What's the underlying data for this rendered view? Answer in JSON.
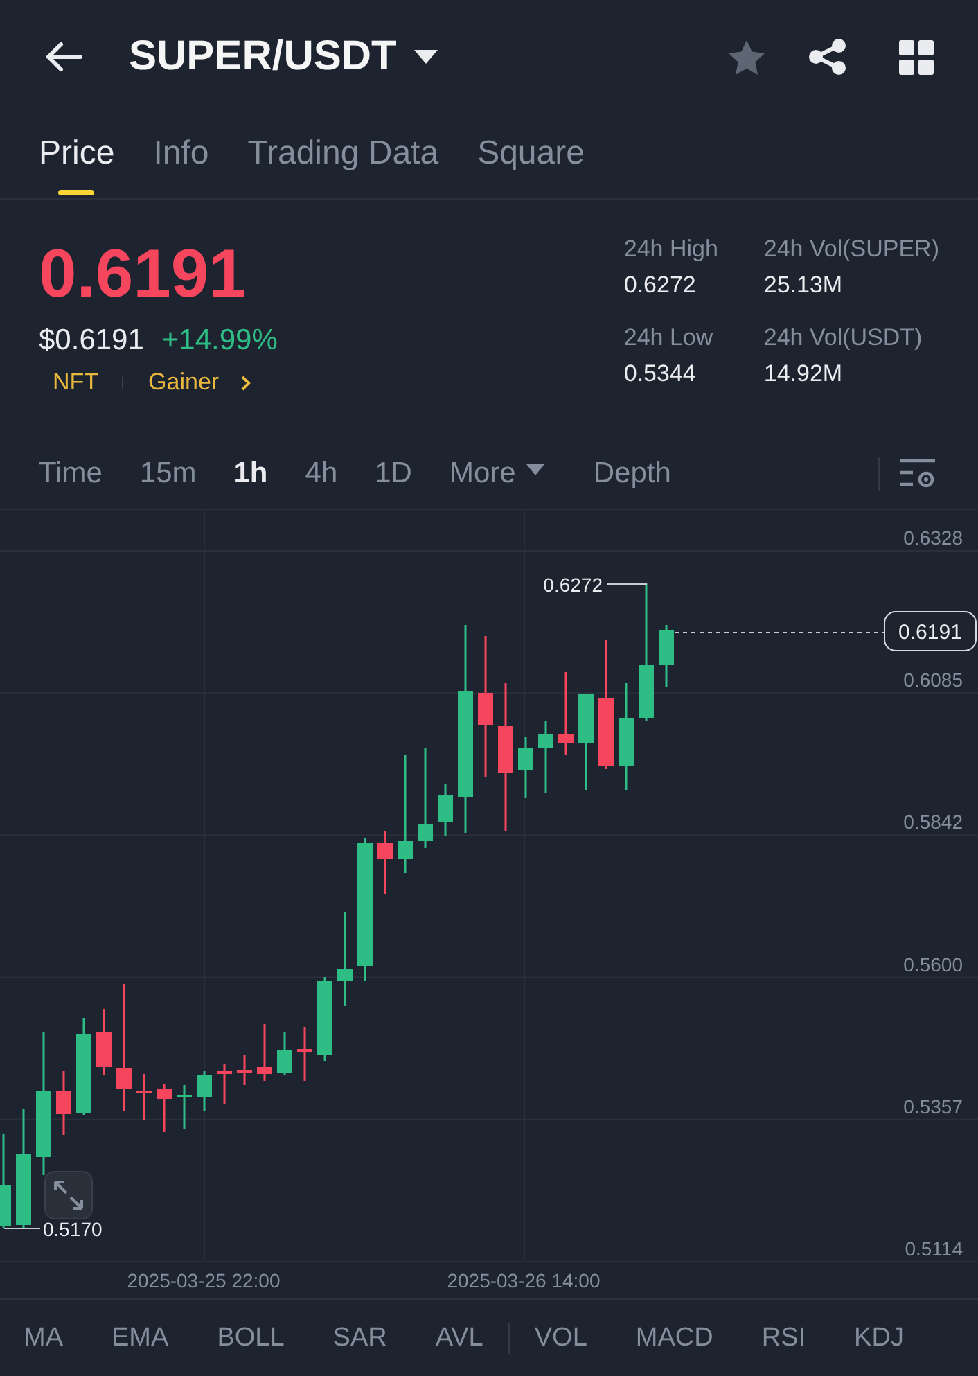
{
  "header": {
    "title": "SUPER/USDT",
    "favorited": false
  },
  "tabs": [
    {
      "label": "Price",
      "selected": true
    },
    {
      "label": "Info",
      "selected": false
    },
    {
      "label": "Trading Data",
      "selected": false
    },
    {
      "label": "Square",
      "selected": false
    }
  ],
  "ticker": {
    "last_price": "0.6191",
    "falling": true,
    "usd_price": "$0.6191",
    "change": "+14.99%",
    "tags": [
      "NFT",
      "Gainer"
    ]
  },
  "stats": [
    {
      "label": "24h High",
      "value": "0.6272"
    },
    {
      "label": "24h Vol(SUPER)",
      "value": "25.13M"
    },
    {
      "label": "24h Low",
      "value": "0.5344"
    },
    {
      "label": "24h Vol(USDT)",
      "value": "14.92M"
    }
  ],
  "intervals": [
    {
      "label": "Time",
      "kind": "option",
      "selected": false
    },
    {
      "label": "15m",
      "kind": "option",
      "selected": false
    },
    {
      "label": "1h",
      "kind": "option",
      "selected": true
    },
    {
      "label": "4h",
      "kind": "option",
      "selected": false
    },
    {
      "label": "1D",
      "kind": "option",
      "selected": false
    },
    {
      "label": "More",
      "kind": "dropdown",
      "selected": false
    },
    {
      "label": "Depth",
      "kind": "option",
      "selected": false
    }
  ],
  "chart": {
    "price_axis": [
      "0.6328",
      "0.6085",
      "0.5842",
      "0.5600",
      "0.5357",
      "0.5114"
    ],
    "time_axis": [
      "2025-03-25 22:00",
      "2025-03-26 14:00"
    ],
    "high_label": "0.6272",
    "low_label": "0.5170",
    "last_price_tag": "0.6191"
  },
  "indicators": {
    "main": [
      "MA",
      "EMA",
      "BOLL",
      "SAR",
      "AVL"
    ],
    "sub": [
      "VOL",
      "MACD",
      "RSI",
      "KDJ"
    ]
  }
}
